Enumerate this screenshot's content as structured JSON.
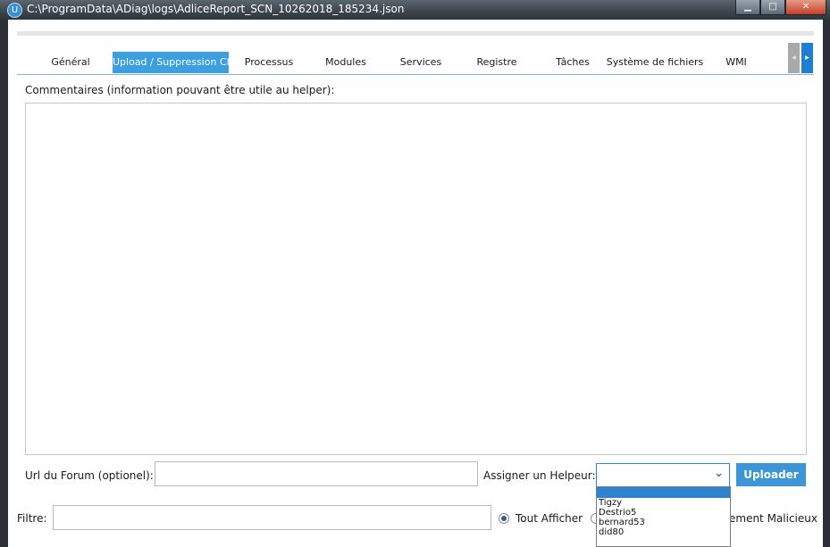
{
  "window": {
    "title": "C:\\ProgramData\\ADiag\\logs\\AdliceReport_SCN_10262018_185234.json",
    "min_glyph": "▁",
    "max_glyph": "□",
    "close_glyph": "✕"
  },
  "tabs": [
    {
      "label": "Général"
    },
    {
      "label": "Upload / Suppression Cloud",
      "active": true
    },
    {
      "label": "Processus"
    },
    {
      "label": "Modules"
    },
    {
      "label": "Services"
    },
    {
      "label": "Registre"
    },
    {
      "label": "Tâches"
    },
    {
      "label": "Système de fichiers"
    },
    {
      "label": "WMI"
    }
  ],
  "tab_scroll": {
    "left_glyph": "◂",
    "right_glyph": "▸"
  },
  "comments": {
    "label": "Commentaires (information pouvant être utile au helper):",
    "value": ""
  },
  "forum": {
    "label": "Url du Forum (optionel):",
    "value": ""
  },
  "helper": {
    "label": "Assigner un Helpeur:",
    "selected": "",
    "options": [
      "",
      "Tigzy",
      "Destrio5",
      "bernard53",
      "did80"
    ],
    "chevron_glyph": "⌄"
  },
  "upload_button": {
    "label": "Uploader"
  },
  "filter": {
    "label": "Filtre:",
    "value": "",
    "radio_all": {
      "label": "Tout Afficher",
      "checked": true
    },
    "radio_malicious": {
      "label": "ement Malicieux"
    }
  },
  "colors": {
    "accent": "#3d9fe0",
    "button": "#3c95d6"
  }
}
